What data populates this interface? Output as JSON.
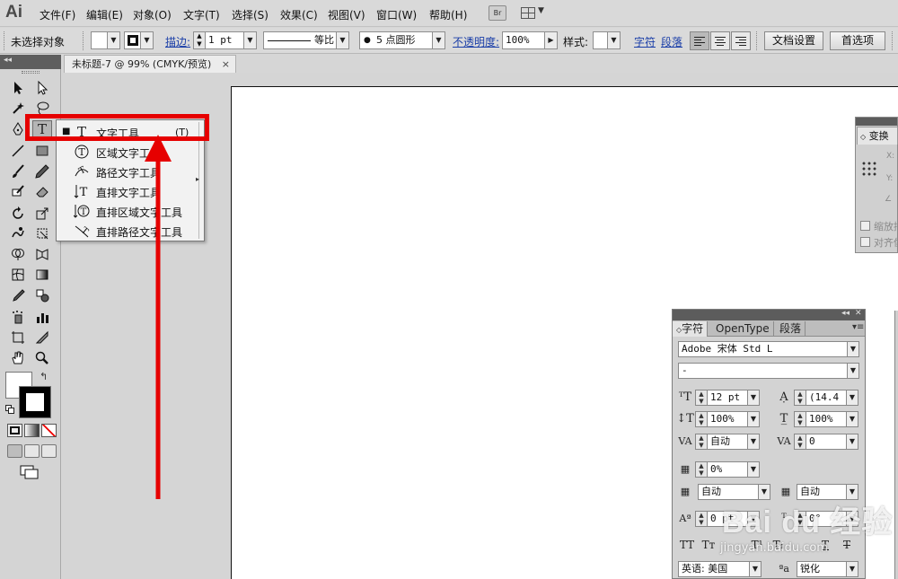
{
  "app": {
    "logo": "Ai",
    "bridge_label": "Br"
  },
  "menu": [
    "文件(F)",
    "编辑(E)",
    "对象(O)",
    "文字(T)",
    "选择(S)",
    "效果(C)",
    "视图(V)",
    "窗口(W)",
    "帮助(H)"
  ],
  "control_bar": {
    "selection_status": "未选择对象",
    "stroke_label": "描边:",
    "stroke_weight": "1 pt",
    "stroke_profile": "等比",
    "brush": "5 点圆形",
    "opacity_label": "不透明度:",
    "opacity_value": "100%",
    "style_label": "样式:",
    "character_link": "字符",
    "paragraph_link": "段落",
    "doc_setup_button": "文档设置",
    "preferences_button": "首选项"
  },
  "document": {
    "tab_title": "未标题-7 @ 99% (CMYK/预览)",
    "close_glyph": "×"
  },
  "flyout": {
    "items": [
      {
        "label": "文字工具",
        "shortcut": "(T)",
        "icon": "type-tool-icon",
        "selected": true
      },
      {
        "label": "区域文字工具",
        "shortcut": "",
        "icon": "area-type-tool-icon",
        "selected": false
      },
      {
        "label": "路径文字工具",
        "shortcut": "",
        "icon": "type-on-path-tool-icon",
        "selected": false
      },
      {
        "label": "直排文字工具",
        "shortcut": "",
        "icon": "vertical-type-tool-icon",
        "selected": false
      },
      {
        "label": "直排区域文字工具",
        "shortcut": "",
        "icon": "vertical-area-type-tool-icon",
        "selected": false
      },
      {
        "label": "直排路径文字工具",
        "shortcut": "",
        "icon": "vertical-type-on-path-tool-icon",
        "selected": false
      }
    ]
  },
  "transform_panel": {
    "tab": "变换",
    "checkbox1": "缩放描边",
    "checkbox2": "对齐像素"
  },
  "character_panel": {
    "tabs": [
      "字符",
      "OpenType",
      "段落"
    ],
    "font_family": "Adobe 宋体 Std L",
    "font_style": "-",
    "font_size": "12 pt",
    "leading": "(14.4",
    "vertical_scale": "100%",
    "horizontal_scale": "100%",
    "kerning": "自动",
    "tracking": "0",
    "tsume": "0%",
    "aki_left": "自动",
    "aki_right": "自动",
    "baseline_shift": "0 pt",
    "rotation": "0°",
    "language": "英语: 美国",
    "antialias": "锐化"
  },
  "watermark": {
    "main": "Bai du 经验",
    "sub": "jingyan.baidu.com"
  },
  "colors": {
    "highlight": "#e60000",
    "arrow": "#e60000",
    "link": "#1a3ea8"
  }
}
